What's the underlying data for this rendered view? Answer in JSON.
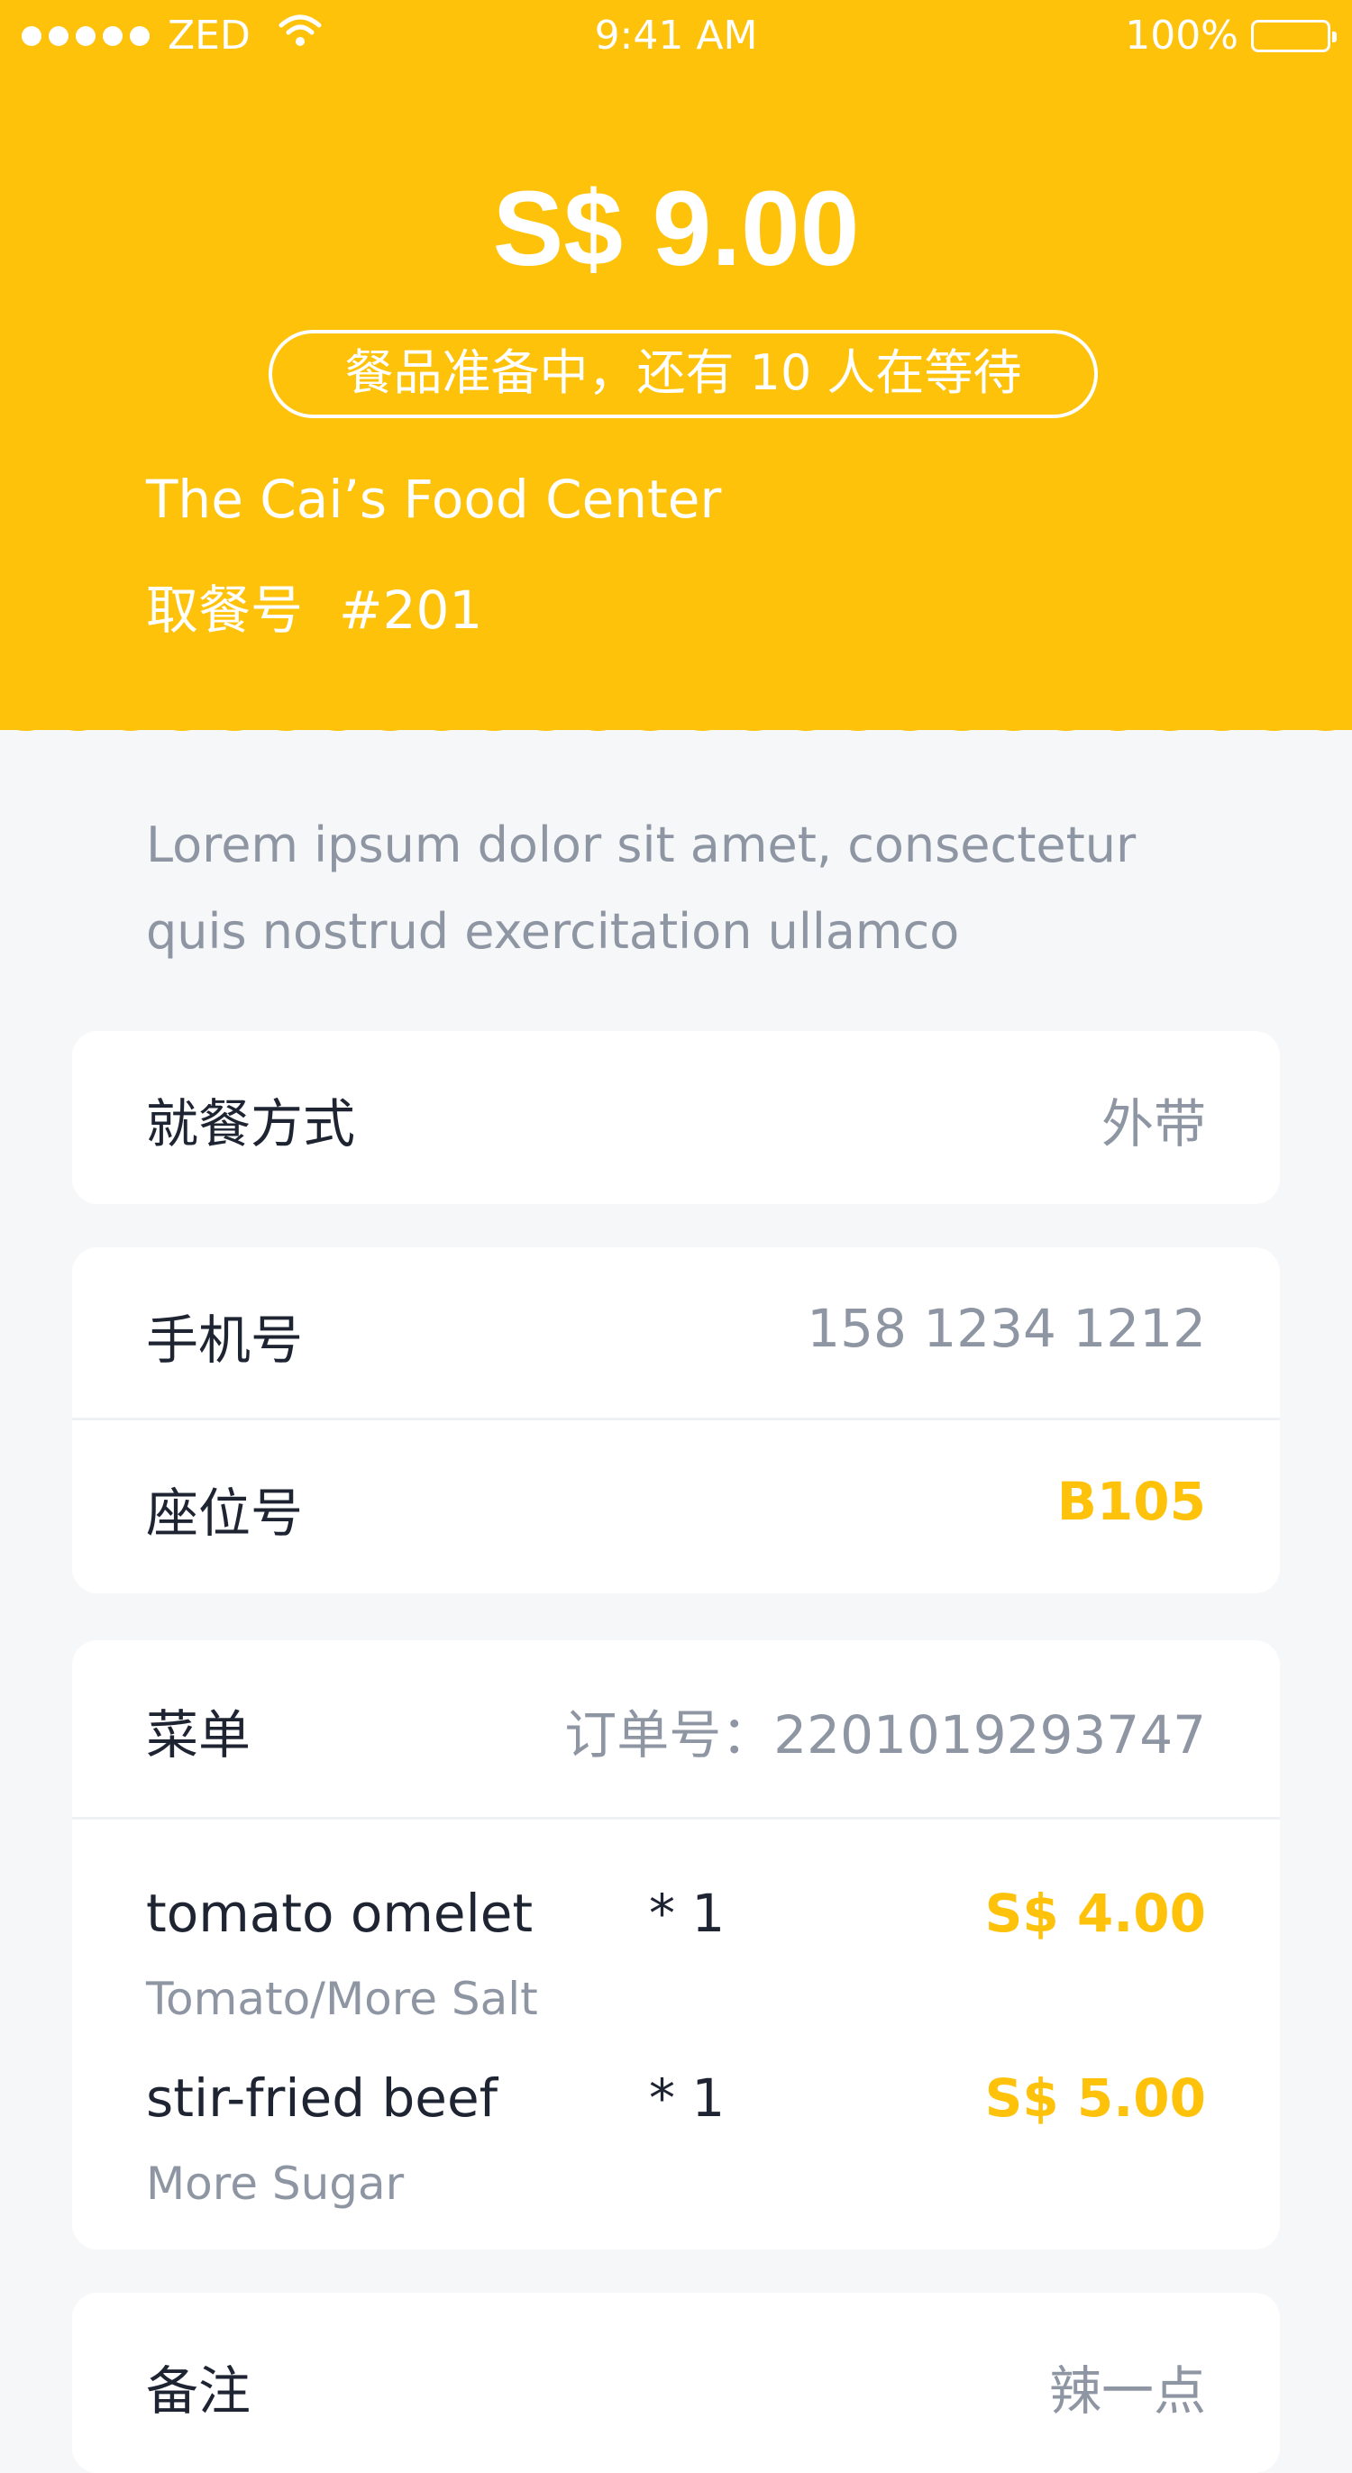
{
  "status_bar": {
    "carrier": "ZED",
    "time": "9:41 AM",
    "battery": "100%",
    "battery_level": 1.0
  },
  "order": {
    "amount": "S$ 9.00",
    "status": "餐品准备中，还有 10 人在等待",
    "restaurant": "The Cai’s Food Center",
    "pickup_label": "取餐号",
    "pickup_number": "#201"
  },
  "note": {
    "line1": "Lorem ipsum dolor sit amet, consectetur",
    "line2": "quis nostrud exercitation ullamco"
  },
  "dining": {
    "label": "就餐方式",
    "value": "外带"
  },
  "contact": {
    "phone_label": "手机号",
    "phone_value": "158 1234 1212",
    "seat_label": "座位号",
    "seat_value": "B105"
  },
  "menu": {
    "label": "菜单",
    "order_no": "订单号：2201019293747",
    "items": [
      {
        "name": "tomato omelet",
        "qty": "* 1",
        "price": "S$ 4.00",
        "options": "Tomato/More Salt"
      },
      {
        "name": "stir-fried beef",
        "qty": "* 1",
        "price": "S$ 5.00",
        "options": "More Sugar"
      }
    ]
  },
  "remark": {
    "label": "备注",
    "value": "辣一点"
  },
  "colors": {
    "brand": "#fec20b",
    "background": "#f6f7f9",
    "text_primary": "#1f2433",
    "text_secondary": "#8f96a3"
  },
  "icons": [
    "signal-dots-icon",
    "wifi-icon",
    "battery-icon"
  ]
}
